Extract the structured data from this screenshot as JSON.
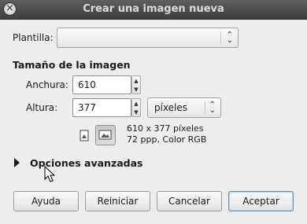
{
  "window": {
    "title": "Crear una imagen nueva"
  },
  "template": {
    "label": "Plantilla:",
    "value": ""
  },
  "image_size": {
    "heading": "Tamaño de la imagen",
    "width_label": "Anchura:",
    "width_value": "610",
    "height_label": "Altura:",
    "height_value": "377",
    "unit": "píxeles"
  },
  "info": {
    "dimensions": "610 x 377 píxeles",
    "resolution": "72 ppp, Color RGB"
  },
  "advanced": {
    "label": "Opciones avanzadas"
  },
  "buttons": {
    "help": "Ayuda",
    "reset": "Reiniciar",
    "cancel": "Cancelar",
    "ok": "Aceptar"
  }
}
